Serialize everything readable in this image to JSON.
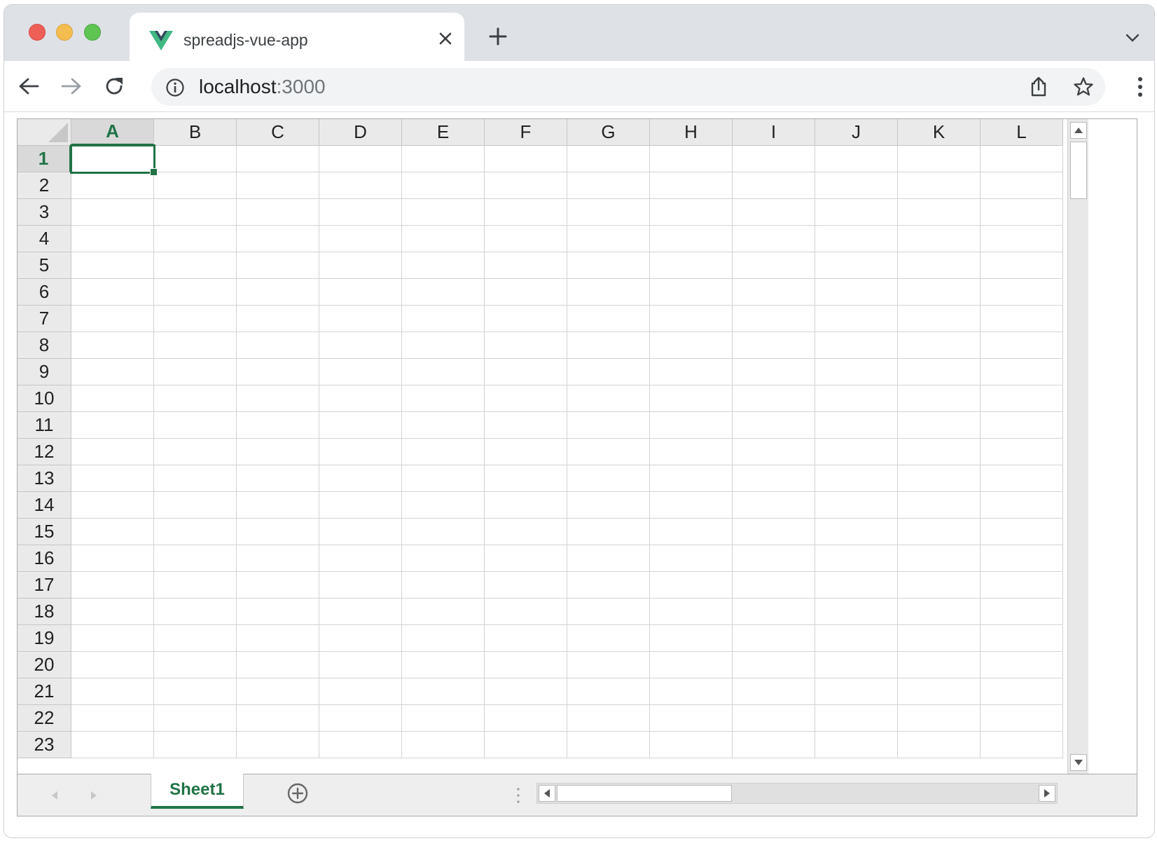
{
  "browser": {
    "tab": {
      "title": "spreadjs-vue-app",
      "favicon": "vue-logo-icon",
      "close_icon": "close-icon"
    },
    "new_tab_icon": "plus-icon",
    "tab_list_icon": "chevron-down-icon",
    "address": {
      "host": "localhost",
      "port": ":3000",
      "info_icon": "info-icon"
    },
    "actions": [
      "back-icon",
      "forward-icon",
      "reload-icon",
      "share-icon",
      "star-icon",
      "kebab-menu-icon"
    ]
  },
  "spreadsheet": {
    "columns": [
      "A",
      "B",
      "C",
      "D",
      "E",
      "F",
      "G",
      "H",
      "I",
      "J",
      "K",
      "L"
    ],
    "rows": [
      "1",
      "2",
      "3",
      "4",
      "5",
      "6",
      "7",
      "8",
      "9",
      "10",
      "11",
      "12",
      "13",
      "14",
      "15",
      "16",
      "17",
      "18",
      "19",
      "20",
      "21",
      "22",
      "23"
    ],
    "active_cell": "A1",
    "accent_color": "#217346",
    "sheet_tabs": [
      {
        "label": "Sheet1",
        "active": true
      }
    ]
  }
}
